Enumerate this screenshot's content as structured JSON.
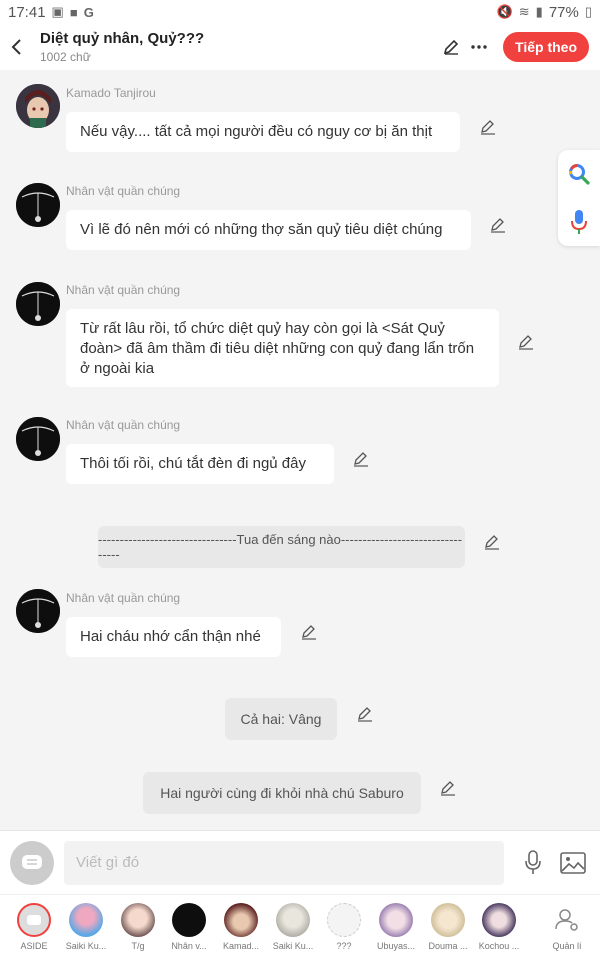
{
  "status_bar": {
    "time": "17:41",
    "battery": "77%"
  },
  "header": {
    "title": "Diệt quỷ nhân, Quỷ???",
    "word_count": "1002 chữ",
    "next_label": "Tiếp theo"
  },
  "messages": [
    {
      "name": "Kamado Tanjirou",
      "text": "Nếu vậy.... tất cả mọi người đều có nguy cơ bị ăn thịt"
    },
    {
      "name": "Nhân vật quần chúng",
      "text": "Vì lẽ đó nên mới có những thợ săn quỷ tiêu diệt chúng"
    },
    {
      "name": "Nhân vật quần chúng",
      "text": "Từ rất lâu rồi, tổ chức diệt quỷ hay còn gọi là <Sát Quỷ đoàn> đã âm thầm đi tiêu diệt những con quỷ đang lẩn trốn ở ngoài kia"
    },
    {
      "name": "Nhân vật quần chúng",
      "text": "Thôi tối rồi, chú tắt đèn đi ngủ đây"
    },
    {
      "narration": "--------------------------------Tua đến sáng nào---------------------------------"
    },
    {
      "name": "Nhân vật quần chúng",
      "text": "Hai cháu nhớ cẩn thận nhé"
    },
    {
      "narration": "Cả hai: Vâng"
    },
    {
      "narration": "Hai người cùng đi khỏi nhà chú Saburo"
    }
  ],
  "input": {
    "placeholder": "Viết gì đó"
  },
  "characters": [
    {
      "name": "ASIDE"
    },
    {
      "name": "Saiki Ku..."
    },
    {
      "name": "T/g"
    },
    {
      "name": "Nhân v..."
    },
    {
      "name": "Kamad..."
    },
    {
      "name": "Saiki Ku..."
    },
    {
      "name": "???"
    },
    {
      "name": "Ubuyas..."
    },
    {
      "name": "Douma ..."
    },
    {
      "name": "Kochou ..."
    },
    {
      "name": "Quản lí"
    }
  ],
  "colors": {
    "accent": "#f0413f",
    "bubble": "#ffffff",
    "narration": "#e8e8e8"
  }
}
